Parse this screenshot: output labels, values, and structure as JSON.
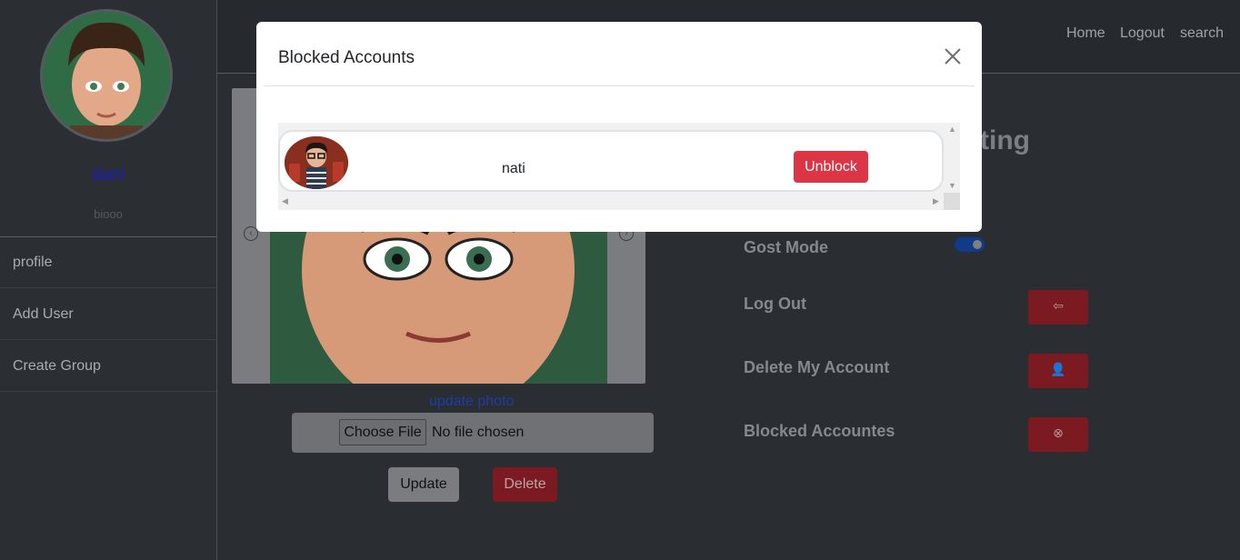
{
  "sidebar": {
    "name": "dani",
    "bio": "biooo",
    "items": [
      {
        "label": "profile"
      },
      {
        "label": "Add User"
      },
      {
        "label": "Create Group"
      }
    ]
  },
  "nav": {
    "links": [
      "Home",
      "Logout",
      "search"
    ]
  },
  "profile_photo": {
    "update_link": "update photo",
    "choose_file": "Choose File",
    "file_status": "No file chosen",
    "update_label": "Update",
    "delete_label": "Delete"
  },
  "settings": {
    "title_fragment": "ting",
    "ghost_mode": "Gost Mode",
    "ghost_mode_on": true,
    "log_out": "Log Out",
    "delete_account": "Delete My Account",
    "blocked_accounts": "Blocked Accountes"
  },
  "modal": {
    "title": "Blocked Accounts",
    "blocked_users": [
      {
        "name": "nati",
        "action": "Unblock"
      }
    ]
  },
  "colors": {
    "danger": "#dc3545",
    "sidebar_name": "#1c1cc0",
    "link": "#1d3ea6"
  }
}
